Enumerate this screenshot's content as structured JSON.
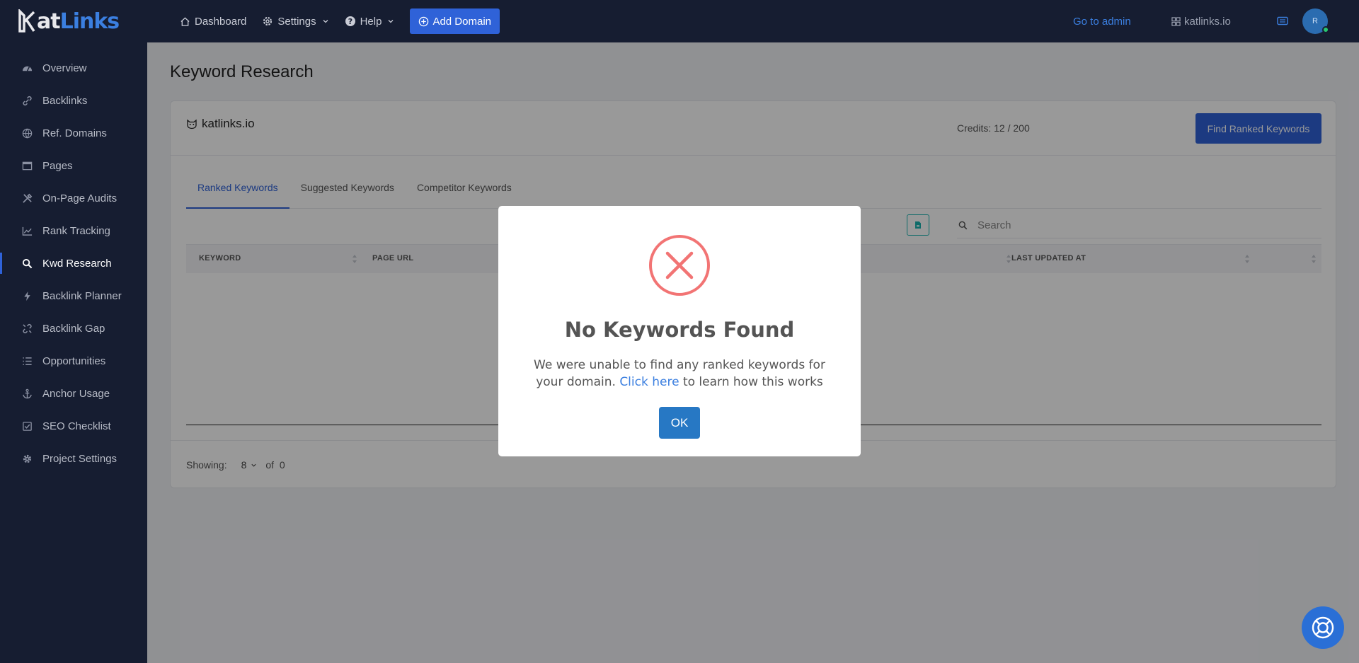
{
  "app": {
    "logo_prefix": "K",
    "logo_k": "at",
    "logo_links": "Links"
  },
  "sidebar": {
    "items": [
      {
        "label": "Overview",
        "icon": "dashboard-gauge-icon"
      },
      {
        "label": "Backlinks",
        "icon": "link-icon"
      },
      {
        "label": "Ref. Domains",
        "icon": "globe-icon"
      },
      {
        "label": "Pages",
        "icon": "browser-window-icon"
      },
      {
        "label": "On-Page Audits",
        "icon": "tools-icon"
      },
      {
        "label": "Rank Tracking",
        "icon": "line-chart-icon"
      },
      {
        "label": "Kwd Research",
        "icon": "search-icon",
        "active": true
      },
      {
        "label": "Backlink Planner",
        "icon": "bolt-icon"
      },
      {
        "label": "Backlink Gap",
        "icon": "broken-link-icon"
      },
      {
        "label": "Opportunities",
        "icon": "list-icon"
      },
      {
        "label": "Anchor Usage",
        "icon": "anchor-icon"
      },
      {
        "label": "SEO Checklist",
        "icon": "checkbox-icon"
      },
      {
        "label": "Project Settings",
        "icon": "gear-icon"
      }
    ]
  },
  "topbar": {
    "dashboard": "Dashboard",
    "settings": "Settings",
    "help": "Help",
    "add_domain": "Add Domain",
    "go_to_admin": "Go to admin",
    "site": "katlinks.io",
    "avatar_initial": "R"
  },
  "main": {
    "title": "Keyword Research",
    "domain": "katlinks.io",
    "credits": "Credits: 12 / 200",
    "find_button": "Find Ranked Keywords",
    "tabs": [
      "Ranked Keywords",
      "Suggested Keywords",
      "Competitor Keywords"
    ],
    "search_placeholder": "Search",
    "columns": [
      "KEYWORD",
      "PAGE URL",
      "LAST UPDATED AT"
    ],
    "showing_label": "Showing:",
    "per_page": "8",
    "of_label": "of",
    "total": "0"
  },
  "modal": {
    "title": "No Keywords Found",
    "text_before": "We were unable to find any ranked keywords for your domain.",
    "link_text": "Click here",
    "text_after": "to learn how this works",
    "ok_label": "OK",
    "icon": "error-x-circle-icon",
    "icon_color": "#f27474"
  },
  "colors": {
    "accent": "#2f62d8",
    "sidebar_bg": "#161d31",
    "teal": "#1ab3b0"
  }
}
